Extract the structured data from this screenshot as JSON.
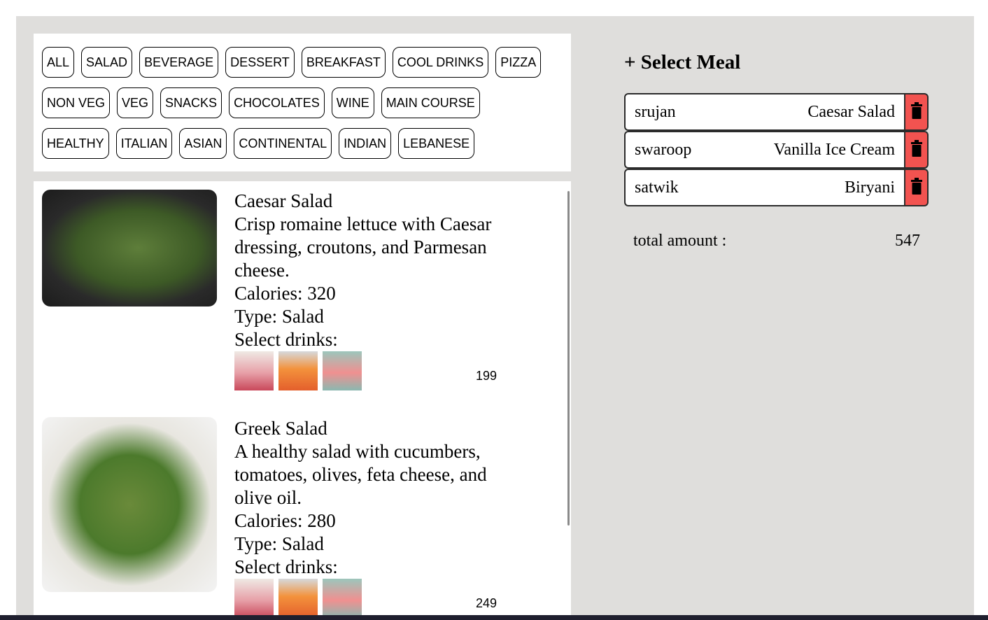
{
  "filters": {
    "row1": [
      "ALL",
      "SALAD",
      "BEVERAGE",
      "DESSERT",
      "BREAKFAST",
      "COOL DRINKS",
      "PIZZA"
    ],
    "row2": [
      "NON VEG",
      "VEG",
      "SNACKS",
      "CHOCOLATES",
      "WINE",
      "MAIN COURSE"
    ],
    "row3": [
      "HEALTHY",
      "ITALIAN",
      "ASIAN",
      "CONTINENTAL",
      "INDIAN",
      "LEBANESE"
    ]
  },
  "meals": [
    {
      "name": "Caesar Salad",
      "description": "Crisp romaine lettuce with Caesar dressing, croutons, and Parmesan cheese.",
      "calories": "Calories: 320",
      "type": "Type: Salad",
      "drinks_label": "Select drinks:",
      "price": "199"
    },
    {
      "name": "Greek Salad",
      "description": "A healthy salad with cucumbers, tomatoes, olives, feta cheese, and olive oil.",
      "calories": "Calories: 280",
      "type": "Type: Salad",
      "drinks_label": "Select drinks:",
      "price": "249"
    }
  ],
  "order": {
    "title": "+ Select Meal",
    "items": [
      {
        "person": "srujan",
        "meal": "Caesar Salad"
      },
      {
        "person": "swaroop",
        "meal": "Vanilla Ice Cream"
      },
      {
        "person": "satwik",
        "meal": "Biryani"
      }
    ],
    "total_label": "total amount :",
    "total_value": "547"
  },
  "icons": {
    "delete": "trash-icon"
  },
  "colors": {
    "delete_button": "#f25350",
    "app_background": "#dfdedc"
  }
}
